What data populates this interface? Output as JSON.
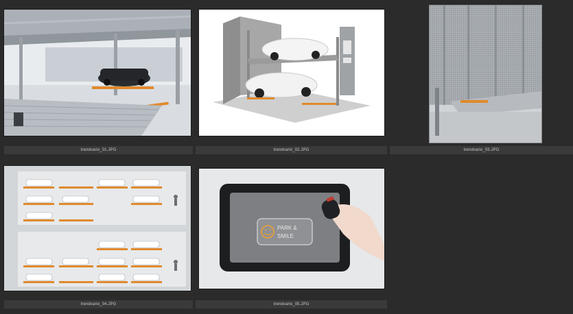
{
  "gallery": {
    "items": [
      {
        "filename": "trendvario_01.JPG",
        "icon": "photo-thumbnail",
        "subject": "parking-deck-photo"
      },
      {
        "filename": "trendvario_02.JPG",
        "icon": "photo-thumbnail",
        "subject": "parking-lift-render"
      },
      {
        "filename": "trendvario_03.JPG",
        "icon": "photo-thumbnail",
        "subject": "mesh-facade-photo"
      },
      {
        "filename": "trendvario_04.JPG",
        "icon": "photo-thumbnail",
        "subject": "parking-layout-diagram"
      },
      {
        "filename": "trendvario_05.JPG",
        "icon": "photo-thumbnail",
        "subject": "tablet-app-photo"
      }
    ],
    "tablet_logo_line1": "PARK &",
    "tablet_logo_line2": "SMILE",
    "accent_color": "#e08a2c",
    "background_color": "#2b2b2b",
    "caption_bar_color": "#3a3a3a"
  }
}
